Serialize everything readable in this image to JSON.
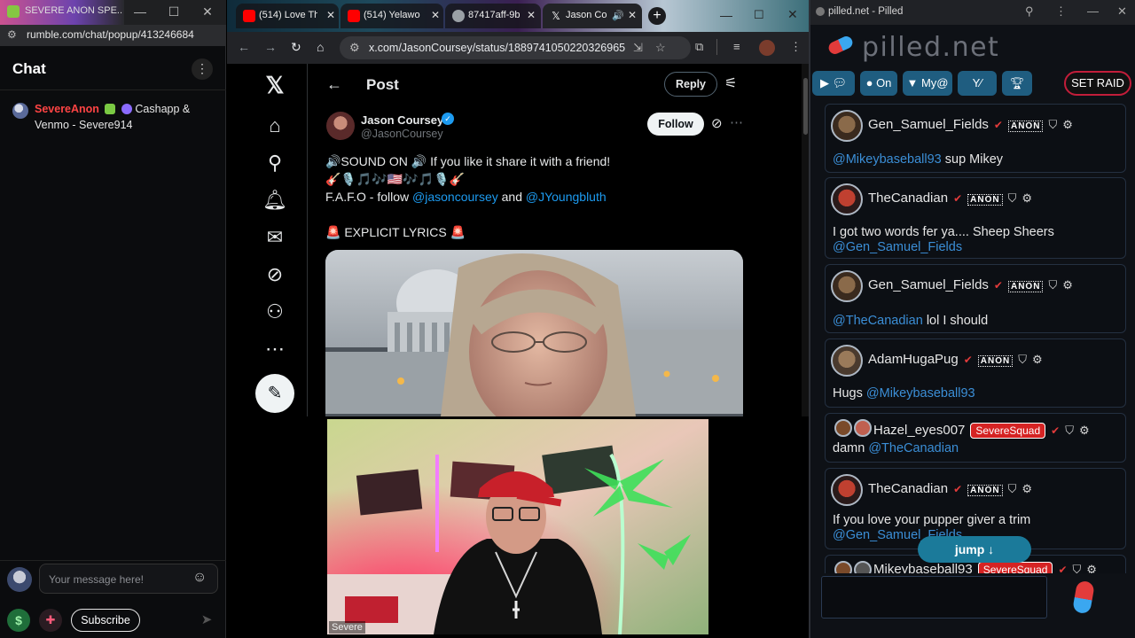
{
  "rumble": {
    "window_title": "SEVERE ANON SPE...",
    "url": "rumble.com/chat/popup/413246684",
    "header_title": "Chat",
    "messages": [
      {
        "user": "SevereAnon",
        "text": "Cashapp & Venmo - Severe914"
      }
    ],
    "composer": {
      "placeholder": "Your message here!",
      "subscribe_label": "Subscribe",
      "dollar_label": "$"
    }
  },
  "chrome": {
    "tabs": [
      {
        "label": "(514) Love Th",
        "favicon_color": "#ff0000"
      },
      {
        "label": "(514) Yelawo",
        "favicon_color": "#ff0000"
      },
      {
        "label": "87417aff-9b",
        "favicon_color": "#9aa0a6"
      },
      {
        "label": "Jason Co",
        "favicon_color": "#ffffff"
      }
    ],
    "url": "x.com/JasonCoursey/status/1889741050220326965"
  },
  "x_post": {
    "header_title": "Post",
    "reply_label": "Reply",
    "follow_label": "Follow",
    "author_name": "Jason Coursey",
    "author_handle": "@JasonCoursey",
    "line1": "🔊SOUND ON 🔊 If you like it share it with a friend!",
    "line2": "🎸🎙️🎵🎶🇺🇸🎶🎵🎙️🎸",
    "line3_prefix": "F.A.F.O - follow ",
    "line3_link1": "@jasoncoursey",
    "line3_mid": " and ",
    "line3_link2": "@JYoungbluth",
    "line4": "🚨 EXPLICIT LYRICS 🚨"
  },
  "webcam": {
    "label": "Severe"
  },
  "pilled": {
    "window_title": "pilled.net - Pilled",
    "brand": "pilled.net",
    "toolbar": {
      "on_label": "On",
      "my_label": "My@",
      "raid_label": "SET RAID"
    },
    "messages": [
      {
        "user": "Gen_Samuel_Fields",
        "mention": "@Mikeybaseball93",
        "text": " sup Mikey"
      },
      {
        "user": "TheCanadian",
        "text": "I got two words fer ya.... Sheep Sheers",
        "mention": "@Gen_Samuel_Fields"
      },
      {
        "user": "Gen_Samuel_Fields",
        "mention": "@TheCanadian",
        "text": " lol I should"
      },
      {
        "user": "AdamHugaPug",
        "text": "Hugs ",
        "mention": "@Mikeybaseball93"
      },
      {
        "user": "Hazel_eyes007",
        "squad": "SevereSquad",
        "text": "damn ",
        "mention": "@TheCanadian"
      },
      {
        "user": "TheCanadian",
        "text": "If you love your pupper giver a trim",
        "mention": "@Gen_Samuel_Fields"
      },
      {
        "user": "Mikeybaseball93",
        "squad": "SevereSquad"
      }
    ],
    "anon_badge": "ANON",
    "jump_label": "jump ↓"
  },
  "colors": {
    "x_link": "#1d9bf0",
    "rumble_user": "#ff4444",
    "pilled_mention": "#3b8ed6",
    "squad_red": "#d52323"
  }
}
